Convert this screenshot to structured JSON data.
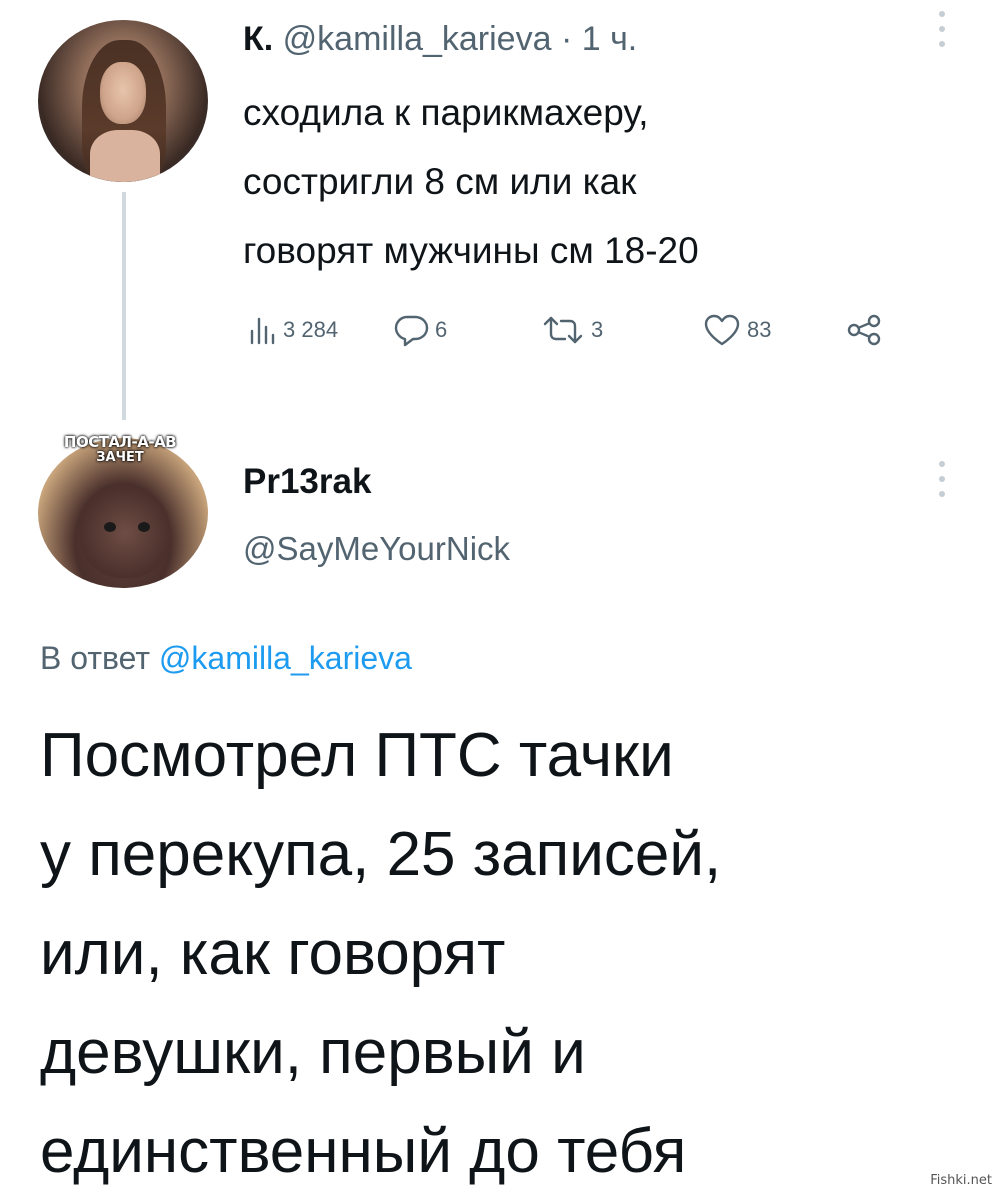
{
  "tweet1": {
    "display_name": "К.",
    "handle": "@kamilla_karieva",
    "separator": "·",
    "time": "1 ч.",
    "text_lines": [
      "сходила к парикмахеру,",
      "состригли 8 см или как",
      "говорят мужчины см 18-20"
    ],
    "stats": {
      "views": "3 284",
      "replies": "6",
      "retweets": "3",
      "likes": "83"
    },
    "more_icon": "vertical-dots-icon"
  },
  "tweet2": {
    "display_name": "Pr13rak",
    "handle": "@SayMeYourNick",
    "avatar_caption_line1": "ПОСТАЛ-А-АВ",
    "avatar_caption_line2": "ЗАЧЕТ",
    "reply_prefix": "В ответ",
    "reply_mention": "@kamilla_karieva",
    "text_lines": [
      "Посмотрел ПТС тачки",
      "у перекупа, 25 записей,",
      "или, как говорят",
      "девушки, первый и",
      "единственный до тебя"
    ],
    "more_icon": "vertical-dots-icon"
  },
  "watermark": "Fishki.net",
  "colors": {
    "text": "#0f1419",
    "secondary": "#536471",
    "link": "#1d9bf0",
    "thread_line": "#cfd9de"
  }
}
